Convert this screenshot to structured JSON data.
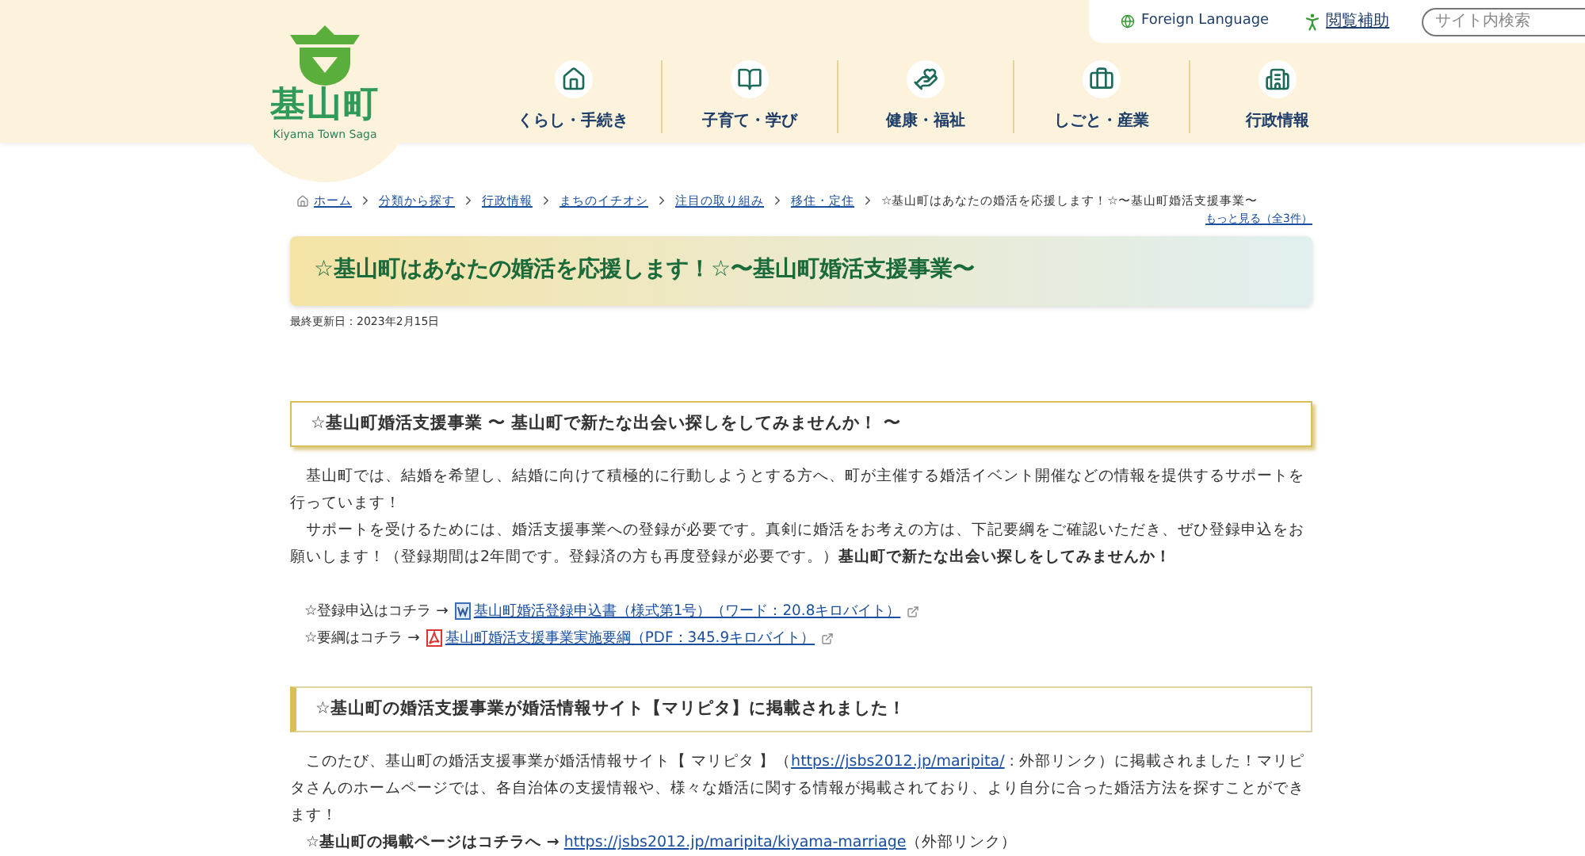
{
  "header": {
    "logo": {
      "name": "基山町",
      "subtitle": "Kiyama Town Saga"
    },
    "utility": {
      "foreign_language": "Foreign Language",
      "accessibility": "閲覧補助",
      "search_placeholder": "サイト内検索"
    },
    "nav": [
      {
        "label": "くらし・手続き",
        "kind": "house"
      },
      {
        "label": "子育て・学び",
        "kind": "book"
      },
      {
        "label": "健康・福祉",
        "kind": "care"
      },
      {
        "label": "しごと・産業",
        "kind": "bag"
      },
      {
        "label": "行政情報",
        "kind": "building"
      }
    ]
  },
  "breadcrumb": [
    {
      "label": "ホーム",
      "link": true
    },
    {
      "label": "分類から探す",
      "link": true
    },
    {
      "label": "行政情報",
      "link": true
    },
    {
      "label": "まちのイチオシ",
      "link": true
    },
    {
      "label": "注目の取り組み",
      "link": true
    },
    {
      "label": "移住・定住",
      "link": true
    },
    {
      "label": "☆基山町はあなたの婚活を応援します！☆〜基山町婚活支援事業〜",
      "link": false
    }
  ],
  "more_link": "もっと見る（全3件）",
  "title": "☆基山町はあなたの婚活を応援します！☆〜基山町婚活支援事業〜",
  "updated": "最終更新日：2023年2月15日",
  "sections": [
    {
      "heading": "☆基山町婚活支援事業 〜 基山町で新たな出会い探しをしてみませんか！ 〜",
      "kind": "boxed",
      "blocks": [
        {
          "kind": "paragraph",
          "parts": [
            {
              "kind": "text",
              "text": "　基山町では、結婚を希望し、結婚に向けて積極的に行動しようとする方へ、町が主催する婚活イベント開催などの情報を提供するサポートを行っています！"
            }
          ]
        },
        {
          "kind": "paragraph",
          "parts": [
            {
              "kind": "text",
              "text": "　サポートを受けるためには、婚活支援事業への登録が必要です。真剣に婚活をお考えの方は、下記要綱をご確認いただき、ぜひ登録申込をお願いします！（登録期間は2年間です。登録済の方も再度登録が必要です。）**基山町で新たな出会い探しをしてみませんか！**"
            }
          ]
        },
        {
          "kind": "spacer"
        },
        {
          "kind": "file_link",
          "prefix": "　☆登録申込はコチラ →",
          "icon": {
            "kind": "word"
          },
          "link": "基山町婚活登録申込書（様式第1号）（ワード：20.8キロバイト）"
        },
        {
          "kind": "file_link",
          "prefix": "　☆要綱はコチラ →",
          "icon": {
            "kind": "pdf"
          },
          "link": "基山町婚活支援事業実施要綱（PDF：345.9キロバイト）"
        }
      ]
    },
    {
      "heading": "☆基山町の婚活支援事業が婚活情報サイト【マリピタ】に掲載されました！",
      "kind": "sidebar",
      "blocks": [
        {
          "kind": "paragraph",
          "parts": [
            {
              "kind": "text",
              "text": "　このたび、基山町の婚活支援事業が婚活情報サイト【 マリピタ 】（"
            },
            {
              "kind": "link",
              "text": "https://jsbs2012.jp/maripita/"
            },
            {
              "kind": "text",
              "text": " : 外部リンク）に掲載されました！マリピタさんのホームページでは、各自治体の支援情報や、様々な婚活に関する情報が掲載されており、より自分に合った婚活方法を探すことができます！"
            }
          ]
        },
        {
          "kind": "paragraph",
          "parts": [
            {
              "kind": "text",
              "text": "　**☆基山町の掲載ページはコチラへ →** "
            },
            {
              "kind": "link",
              "text": "https://jsbs2012.jp/maripita/kiyama-marriage"
            },
            {
              "kind": "text",
              "text": "（外部リンク）"
            }
          ]
        }
      ]
    }
  ]
}
